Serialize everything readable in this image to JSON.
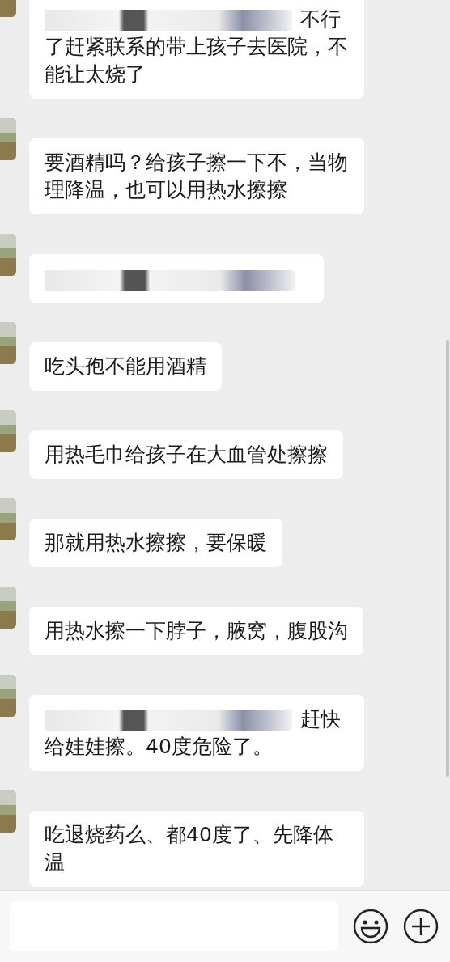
{
  "messages": [
    {
      "kind": "mention",
      "text": "不行了赶紧联系的带上孩子去医院，不能让太烧了"
    },
    {
      "kind": "text",
      "text": "要酒精吗？给孩子擦一下不，当物理降温，也可以用热水擦擦"
    },
    {
      "kind": "redacted"
    },
    {
      "kind": "text",
      "text": "吃头孢不能用酒精"
    },
    {
      "kind": "text",
      "text": "用热毛巾给孩子在大血管处擦擦"
    },
    {
      "kind": "text",
      "text": "那就用热水擦擦，要保暖"
    },
    {
      "kind": "text",
      "text": "用热水擦一下脖子，腋窝，腹股沟"
    },
    {
      "kind": "mention",
      "text": "赶快给娃娃擦。40度危险了。"
    },
    {
      "kind": "text",
      "text": "吃退烧药么、都40度了、先降体温"
    }
  ]
}
